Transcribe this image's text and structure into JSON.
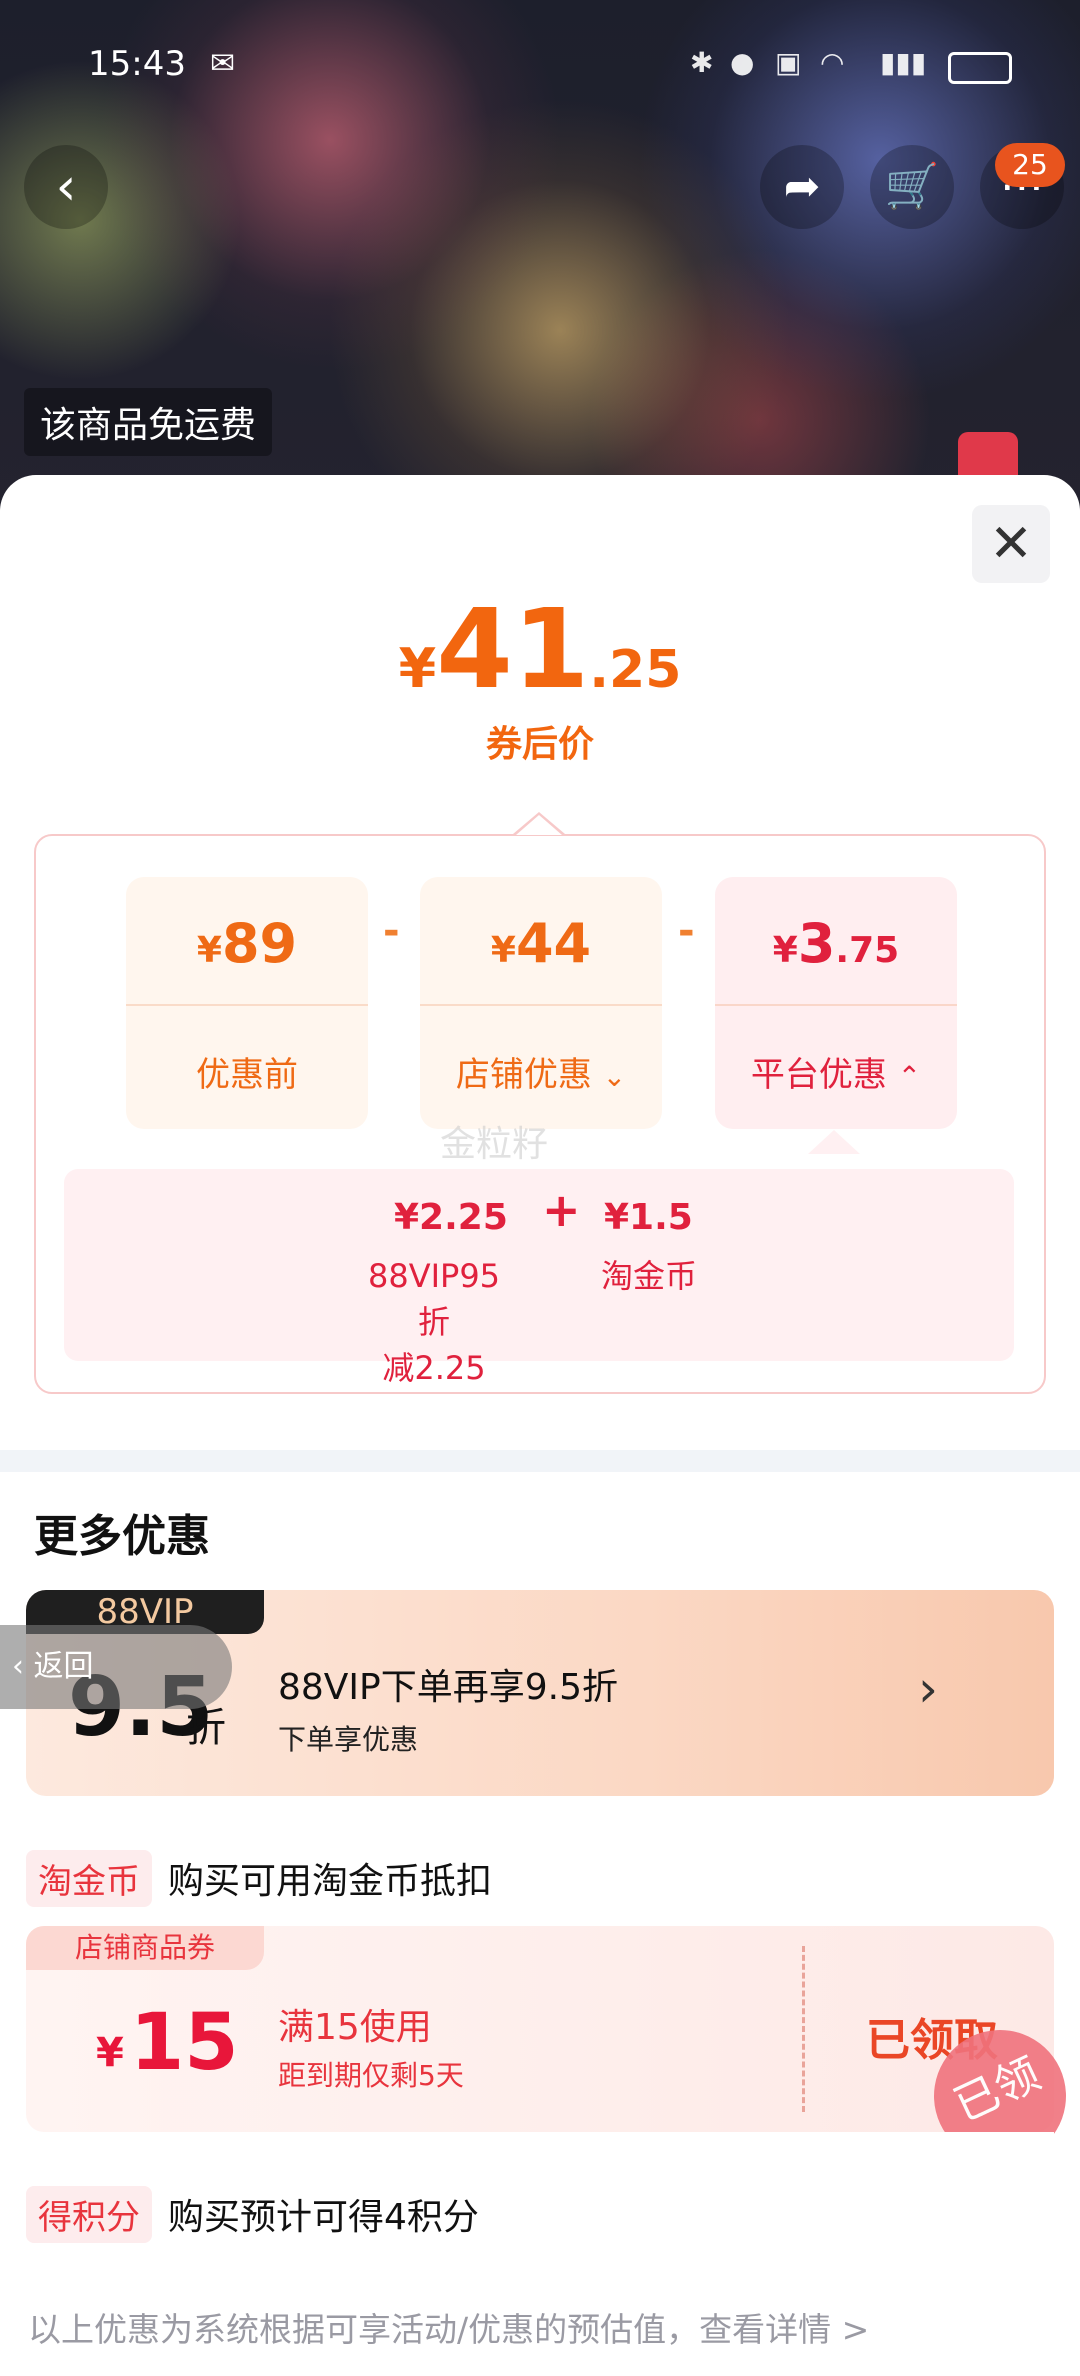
{
  "status_bar": {
    "time": "15:43"
  },
  "header": {
    "cart_count": "25",
    "free_shipping": "该商品免运费"
  },
  "price": {
    "currency": "¥",
    "integer": "41",
    "decimal": ".25",
    "label": "券后价"
  },
  "breakdown": {
    "before": {
      "currency": "¥",
      "value": "89",
      "label": "优惠前"
    },
    "store": {
      "currency": "¥",
      "value": "44",
      "label": "店铺优惠"
    },
    "platform": {
      "currency": "¥",
      "integer": "3",
      "decimal": ".75",
      "label": "平台优惠"
    },
    "minus": "-",
    "watermark": "金粒籽",
    "platform_details": [
      {
        "value": "¥2.25",
        "label_line1": "88VIP95折",
        "label_line2": "减2.25"
      },
      {
        "value": "¥1.5",
        "label_line1": "淘金币",
        "label_line2": ""
      }
    ],
    "plus": "+"
  },
  "more": {
    "title": "更多优惠",
    "vip": {
      "badge": "88VIP",
      "discount": "9.5",
      "unit": "折",
      "title": "88VIP下单再享9.5折",
      "subtitle": "下单享优惠"
    },
    "back": "返回",
    "taojinbi": {
      "tag": "淘金币",
      "text": "购买可用淘金币抵扣"
    },
    "coupon": {
      "tag": "店铺商品券",
      "currency": "¥",
      "amount": "15",
      "condition": "满15使用",
      "expiry": "距到期仅剩5天",
      "status": "已领取",
      "stamp": "已领"
    },
    "points": {
      "tag": "得积分",
      "text": "购买预计可得4积分"
    }
  },
  "footer": "以上优惠为系统根据可享活动/优惠的预估值，查看详情 >",
  "colors": {
    "accent_orange": "#f2660f",
    "accent_red": "#e0213d"
  }
}
